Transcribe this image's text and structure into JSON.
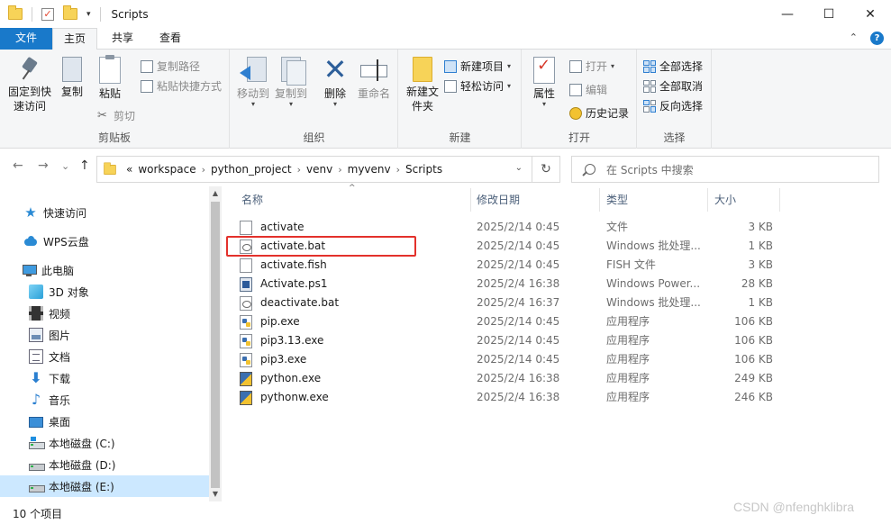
{
  "window": {
    "title": "Scripts",
    "minimize": "—",
    "maximize": "☐",
    "close": "✕"
  },
  "tabs": {
    "file": "文件",
    "home": "主页",
    "share": "共享",
    "view": "查看",
    "expand": "⌃",
    "help": "?"
  },
  "ribbon": {
    "clipboard": {
      "label": "剪贴板",
      "pin": "固定到快速访问",
      "copy": "复制",
      "paste": "粘贴",
      "copy_path": "复制路径",
      "paste_shortcut": "粘贴快捷方式",
      "cut": "剪切"
    },
    "organize": {
      "label": "组织",
      "move_to": "移动到",
      "copy_to": "复制到",
      "delete": "删除",
      "rename": "重命名"
    },
    "new": {
      "label": "新建",
      "new_folder": "新建文件夹",
      "new_item": "新建项目",
      "easy_access": "轻松访问"
    },
    "open": {
      "label": "打开",
      "properties": "属性",
      "open": "打开",
      "edit": "编辑",
      "history": "历史记录"
    },
    "select": {
      "label": "选择",
      "select_all": "全部选择",
      "select_none": "全部取消",
      "invert": "反向选择"
    }
  },
  "address": {
    "back": "←",
    "forward": "→",
    "recent": "⌄",
    "up": "↑",
    "overflow": "«",
    "crumbs": [
      "workspace",
      "python_project",
      "venv",
      "myvenv",
      "Scripts"
    ],
    "separator": "›",
    "dropdown": "⌄",
    "refresh": "↻",
    "search_placeholder": "在 Scripts 中搜索"
  },
  "nav": {
    "quick_access": "快速访问",
    "wps_cloud": "WPS云盘",
    "this_pc": "此电脑",
    "objects_3d": "3D 对象",
    "videos": "视频",
    "pictures": "图片",
    "documents": "文档",
    "downloads": "下载",
    "music": "音乐",
    "desktop": "桌面",
    "drive_c": "本地磁盘 (C:)",
    "drive_d": "本地磁盘 (D:)",
    "drive_e": "本地磁盘 (E:)",
    "scroll_up": "▲",
    "scroll_down": "▼"
  },
  "columns": {
    "name": "名称",
    "date": "修改日期",
    "type": "类型",
    "size": "大小",
    "sort_arrow": "^"
  },
  "files": [
    {
      "name": "activate",
      "date": "2025/2/14 0:45",
      "type": "文件",
      "size": "3 KB",
      "icon": "plain-file-icon"
    },
    {
      "name": "activate.bat",
      "date": "2025/2/14 0:45",
      "type": "Windows 批处理...",
      "size": "1 KB",
      "icon": "batch-file-icon"
    },
    {
      "name": "activate.fish",
      "date": "2025/2/14 0:45",
      "type": "FISH 文件",
      "size": "3 KB",
      "icon": "plain-file-icon"
    },
    {
      "name": "Activate.ps1",
      "date": "2025/2/4 16:38",
      "type": "Windows Power...",
      "size": "28 KB",
      "icon": "powershell-file-icon"
    },
    {
      "name": "deactivate.bat",
      "date": "2025/2/4 16:37",
      "type": "Windows 批处理...",
      "size": "1 KB",
      "icon": "batch-file-icon"
    },
    {
      "name": "pip.exe",
      "date": "2025/2/14 0:45",
      "type": "应用程序",
      "size": "106 KB",
      "icon": "exe-file-icon"
    },
    {
      "name": "pip3.13.exe",
      "date": "2025/2/14 0:45",
      "type": "应用程序",
      "size": "106 KB",
      "icon": "exe-file-icon"
    },
    {
      "name": "pip3.exe",
      "date": "2025/2/14 0:45",
      "type": "应用程序",
      "size": "106 KB",
      "icon": "exe-file-icon"
    },
    {
      "name": "python.exe",
      "date": "2025/2/4 16:38",
      "type": "应用程序",
      "size": "249 KB",
      "icon": "python-file-icon"
    },
    {
      "name": "pythonw.exe",
      "date": "2025/2/4 16:38",
      "type": "应用程序",
      "size": "246 KB",
      "icon": "python-file-icon"
    }
  ],
  "status": {
    "count": "10 个项目",
    "watermark": "CSDN @nfenghklibra"
  },
  "colors": {
    "accent": "#1979ca",
    "highlight_box": "#e3312b",
    "selected_nav": "#cce8ff"
  }
}
